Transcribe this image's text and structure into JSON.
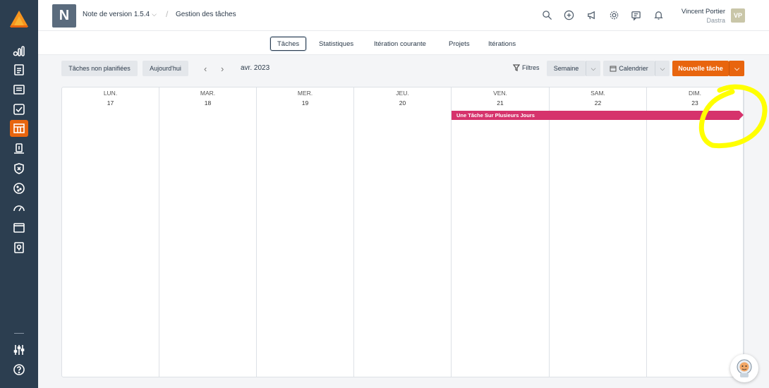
{
  "topbar": {
    "project_initial": "N",
    "version_label": "Note de version 1.5.4",
    "breadcrumb": "Gestion des tâches",
    "user_name": "Vincent Portier",
    "user_org": "Dastra",
    "user_initials": "VP"
  },
  "tabs": [
    {
      "label": "Tâches",
      "active": true
    },
    {
      "label": "Statistiques",
      "active": false
    },
    {
      "label": "Itération courante",
      "active": false
    },
    {
      "label": "Projets",
      "active": false
    },
    {
      "label": "Itérations",
      "active": false
    }
  ],
  "toolbar": {
    "unplanned_label": "Tâches non planifiées",
    "today_label": "Aujourd'hui",
    "month_label": "avr. 2023",
    "filters_label": "Filtres",
    "week_label": "Semaine",
    "calendar_label": "Calendrier",
    "new_task_label": "Nouvelle tâche"
  },
  "calendar": {
    "days": [
      {
        "name": "LUN.",
        "num": "17"
      },
      {
        "name": "MAR.",
        "num": "18"
      },
      {
        "name": "MER.",
        "num": "19"
      },
      {
        "name": "JEU.",
        "num": "20"
      },
      {
        "name": "VEN.",
        "num": "21"
      },
      {
        "name": "SAM.",
        "num": "22"
      },
      {
        "name": "DIM.",
        "num": "23"
      }
    ],
    "event_label": "Une Tâche Sur Plusieurs Jours",
    "event_color": "#d6336c"
  },
  "colors": {
    "sidebar": "#2c3e50",
    "accent": "#e8650e",
    "highlight": "#ffff00"
  }
}
